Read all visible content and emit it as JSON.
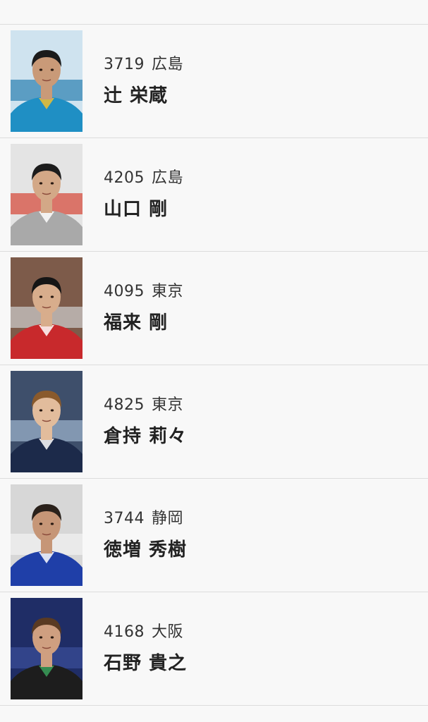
{
  "racers": [
    {
      "number": "3719",
      "region": "広島",
      "name": "辻 栄蔵",
      "photo": {
        "bg": "#cfe3ef",
        "bg2": "#2a7fb0",
        "shirt": "#1f8fc4",
        "accent": "#f0c030",
        "hair": "#1b1b1b",
        "skin": "#c99a78"
      }
    },
    {
      "number": "4205",
      "region": "広島",
      "name": "山口 剛",
      "photo": {
        "bg": "#e4e4e4",
        "bg2": "#d64535",
        "shirt": "#a9a9a9",
        "accent": "#ffffff",
        "hair": "#1c1c1c",
        "skin": "#d3a887"
      }
    },
    {
      "number": "4095",
      "region": "東京",
      "name": "福来 剛",
      "photo": {
        "bg": "#7d5b4a",
        "bg2": "#cfcfcf",
        "shirt": "#c8292c",
        "accent": "#ffffff",
        "hair": "#151515",
        "skin": "#d8ad8c"
      }
    },
    {
      "number": "4825",
      "region": "東京",
      "name": "倉持 莉々",
      "photo": {
        "bg": "#3e4f6b",
        "bg2": "#9fb6cf",
        "shirt": "#1c2a4a",
        "accent": "#ffffff",
        "hair": "#8a5a2c",
        "skin": "#e2bc9c"
      }
    },
    {
      "number": "3744",
      "region": "静岡",
      "name": "徳増 秀樹",
      "photo": {
        "bg": "#d7d7d7",
        "bg2": "#f2f2f2",
        "shirt": "#1f3fa8",
        "accent": "#ffffff",
        "hair": "#2a211b",
        "skin": "#c69677"
      }
    },
    {
      "number": "4168",
      "region": "大阪",
      "name": "石野 貴之",
      "photo": {
        "bg": "#1f2d66",
        "bg2": "#3a4e9a",
        "shirt": "#1d1d1d",
        "accent": "#3aa05a",
        "hair": "#5a3a22",
        "skin": "#cf9f80"
      }
    }
  ]
}
